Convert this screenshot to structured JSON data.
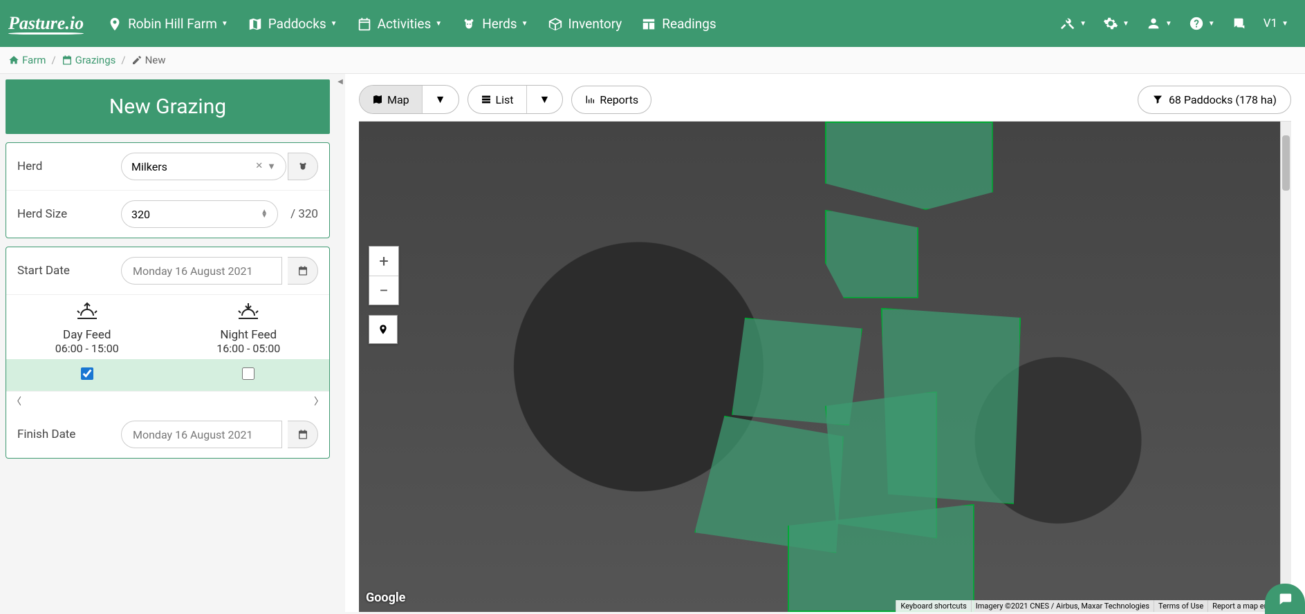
{
  "brand": "Pasture.io",
  "nav": {
    "farm": "Robin Hill Farm",
    "paddocks": "Paddocks",
    "activities": "Activities",
    "herds": "Herds",
    "inventory": "Inventory",
    "readings": "Readings",
    "version": "V1"
  },
  "breadcrumb": {
    "farm": "Farm",
    "grazings": "Grazings",
    "new": "New"
  },
  "panel": {
    "title": "New Grazing"
  },
  "herd": {
    "label": "Herd",
    "selected": "Milkers",
    "size_label": "Herd Size",
    "size_value": "320",
    "size_total": "/ 320"
  },
  "dates": {
    "start_label": "Start Date",
    "start_value": "Monday 16 August 2021",
    "finish_label": "Finish Date",
    "finish_value": "Monday 16 August 2021"
  },
  "feed": {
    "day_label": "Day Feed",
    "day_time": "06:00 - 15:00",
    "night_label": "Night Feed",
    "night_time": "16:00 - 05:00",
    "day_checked": true,
    "night_checked": false
  },
  "views": {
    "map": "Map",
    "list": "List",
    "reports": "Reports"
  },
  "paddock_summary": "68 Paddocks (178 ha)",
  "map": {
    "google": "Google",
    "attr1": "Keyboard shortcuts",
    "attr2": "Imagery ©2021 CNES / Airbus, Maxar Technologies",
    "attr3": "Terms of Use",
    "attr4": "Report a map error"
  }
}
